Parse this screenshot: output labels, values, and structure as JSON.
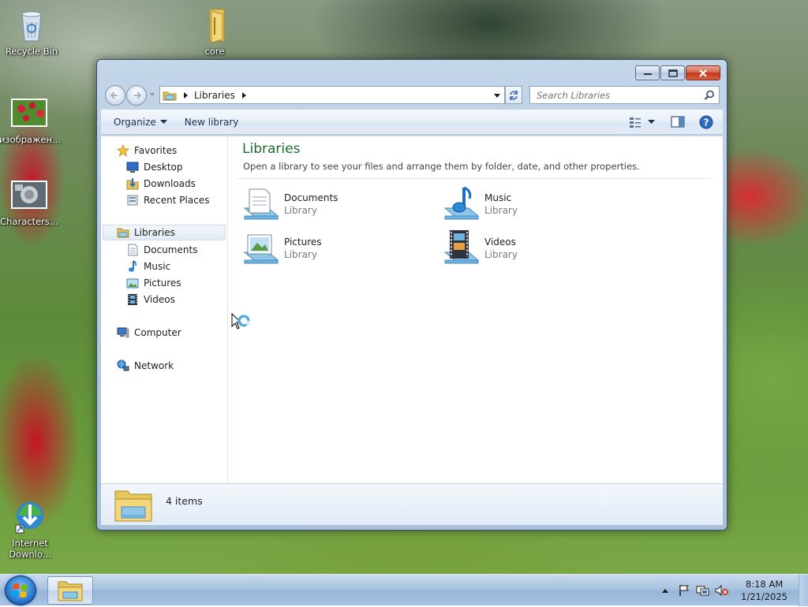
{
  "desktop": {
    "icons": [
      {
        "label": "Recycle Bin"
      },
      {
        "label": "core"
      },
      {
        "label": "изображен..."
      },
      {
        "label": "Characters..."
      },
      {
        "label": "Internet Downlo..."
      }
    ]
  },
  "window": {
    "address": {
      "crumb": "Libraries"
    },
    "search": {
      "placeholder": "Search Libraries"
    },
    "toolbar": {
      "organize": "Organize",
      "new_library": "New library"
    },
    "nav": {
      "favorites": "Favorites",
      "desktop": "Desktop",
      "downloads": "Downloads",
      "recent_places": "Recent Places",
      "libraries": "Libraries",
      "documents": "Documents",
      "music": "Music",
      "pictures": "Pictures",
      "videos": "Videos",
      "computer": "Computer",
      "network": "Network"
    },
    "main": {
      "title": "Libraries",
      "subtitle": "Open a library to see your files and arrange them by folder, date, and other properties.",
      "items": [
        {
          "name": "Documents",
          "type": "Library"
        },
        {
          "name": "Music",
          "type": "Library"
        },
        {
          "name": "Pictures",
          "type": "Library"
        },
        {
          "name": "Videos",
          "type": "Library"
        }
      ]
    },
    "details": {
      "count": "4 items"
    }
  },
  "taskbar": {
    "clock": {
      "time": "8:18 AM",
      "date": "1/21/2025"
    }
  },
  "colors": {
    "title_green": "#1d6a2e",
    "close_red": "#c2351d",
    "taskbar_blue": "#a9c3df"
  }
}
